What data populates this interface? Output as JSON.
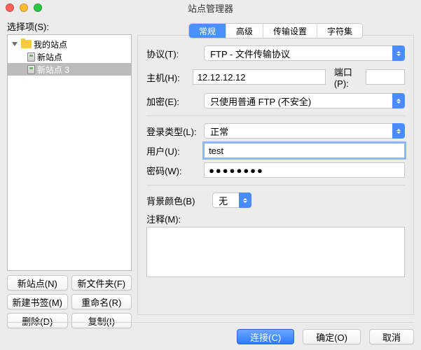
{
  "window": {
    "title": "站点管理器"
  },
  "left": {
    "select_label": "选择项(S):",
    "tree": {
      "root": "我的站点",
      "items": [
        {
          "label": "新站点",
          "selected": false
        },
        {
          "label": "新站点 3",
          "selected": true
        }
      ]
    },
    "buttons": {
      "new_site": "新站点(N)",
      "new_folder": "新文件夹(F)",
      "new_bookmark": "新建书签(M)",
      "rename": "重命名(R)",
      "delete": "删除(D)",
      "copy": "复制(I)"
    }
  },
  "tabs": {
    "general": "常规",
    "advanced": "高级",
    "transfer": "传输设置",
    "charset": "字符集"
  },
  "form": {
    "protocol_label": "协议(T):",
    "protocol_value": "FTP - 文件传输协议",
    "host_label": "主机(H):",
    "host_value": "12.12.12.12",
    "port_label": "端口(P):",
    "port_value": "",
    "encryption_label": "加密(E):",
    "encryption_value": "只使用普通 FTP (不安全)",
    "logon_label": "登录类型(L):",
    "logon_value": "正常",
    "user_label": "用户(U):",
    "user_value": "test",
    "password_label": "密码(W):",
    "password_masked": "●●●●●●●●",
    "bg_label": "背景颜色(B)",
    "bg_value": "无",
    "comment_label": "注释(M):",
    "comment_value": ""
  },
  "footer": {
    "connect": "连接(C)",
    "ok": "确定(O)",
    "cancel": "取消"
  }
}
